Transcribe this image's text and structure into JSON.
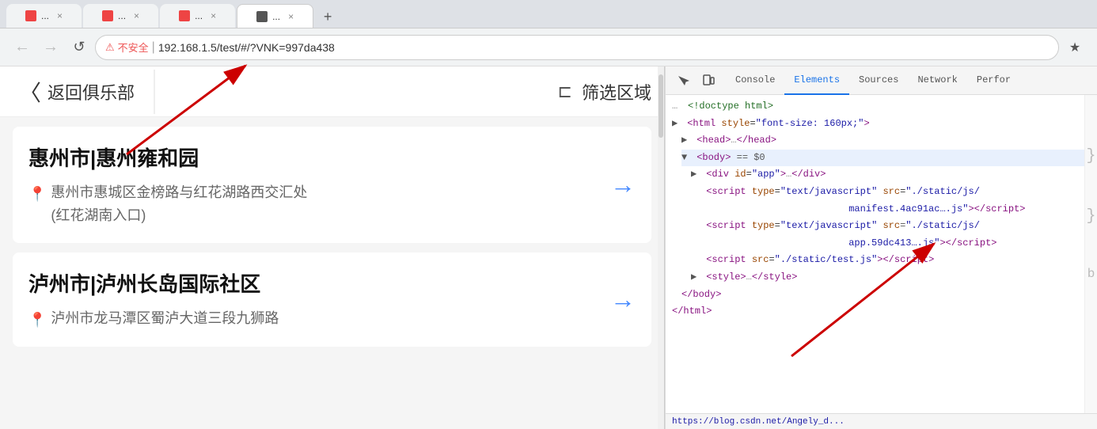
{
  "browser": {
    "tabs": [
      {
        "label": "...",
        "favicon_color": "#e44",
        "active": false
      },
      {
        "label": "...",
        "favicon_color": "#e44",
        "active": false
      },
      {
        "label": "...",
        "favicon_color": "#e44",
        "active": false
      },
      {
        "label": "...",
        "favicon_color": "#555",
        "active": true
      }
    ],
    "nav": {
      "back_label": "←",
      "forward_label": "→",
      "reload_label": "↺"
    },
    "address_bar": {
      "insecure": "不安全",
      "divider": "|",
      "url": "192.168.1.5/test/#/?VNK=997da438"
    }
  },
  "app": {
    "back_button_label": "〈",
    "back_text": "返回俱乐部",
    "filter_label": "筛选区域",
    "cards": [
      {
        "title": "惠州市|惠州雍和园",
        "address_line1": "惠州市惠城区金榜路与红花湖路西交汇处",
        "address_line2": "(红花湖南入口)"
      },
      {
        "title": "泸州市|泸州长岛国际社区",
        "address_line1": "泸州市龙马潭区蜀泸大道三段九狮路"
      }
    ]
  },
  "devtools": {
    "tabs": [
      {
        "label": "Console",
        "active": false
      },
      {
        "label": "Elements",
        "active": true
      },
      {
        "label": "Sources",
        "active": false
      },
      {
        "label": "Network",
        "active": false
      },
      {
        "label": "Perfor",
        "active": false
      }
    ],
    "icons": {
      "cursor": "⬚",
      "device": "▭"
    },
    "code_lines": [
      {
        "indent": 0,
        "expand": "",
        "content": "<!doctype html>",
        "type": "comment"
      },
      {
        "indent": 0,
        "expand": "▶",
        "content": "<html style=\"font-size: 160px;\">",
        "type": "tag"
      },
      {
        "indent": 1,
        "expand": "▶",
        "content": "<head>…</head>",
        "type": "tag"
      },
      {
        "indent": 1,
        "expand": "▼",
        "content": "<body> == $0",
        "type": "tag_highlight"
      },
      {
        "indent": 2,
        "expand": "▶",
        "content": "<div id=\"app\">…</div>",
        "type": "tag"
      },
      {
        "indent": 2,
        "expand": "",
        "content_parts": [
          {
            "text": "<script type=\"text/javascript\" src=\"",
            "type": "tag"
          },
          {
            "text": "./static/js/",
            "type": "normal"
          },
          {
            "text": "manifest.4ac91ac….js",
            "type": "link"
          },
          {
            "text": "\"></",
            "type": "tag"
          },
          {
            "text": "script>",
            "type": "tag"
          }
        ],
        "type": "mixed"
      },
      {
        "indent": 2,
        "expand": "",
        "content_parts": [
          {
            "text": "<script type=\"text/javascript\" src",
            "type": "tag"
          },
          {
            "text": "=\"",
            "type": "tag"
          },
          {
            "text": "./static/js/",
            "type": "normal"
          },
          {
            "text": "app.59dc413….js",
            "type": "link"
          },
          {
            "text": "\"></",
            "type": "tag"
          },
          {
            "text": "script>",
            "type": "tag"
          }
        ],
        "type": "mixed"
      },
      {
        "indent": 2,
        "expand": "",
        "content_parts": [
          {
            "text": "<script src=\"",
            "type": "tag"
          },
          {
            "text": "./static/test",
            "type": "link"
          },
          {
            "text": ".js\"></",
            "type": "tag"
          },
          {
            "text": "script>",
            "type": "tag"
          }
        ],
        "type": "mixed"
      },
      {
        "indent": 2,
        "expand": "▶",
        "content": "<style>…</style>",
        "type": "tag"
      },
      {
        "indent": 1,
        "expand": "",
        "content": "</body>",
        "type": "tag"
      },
      {
        "indent": 0,
        "expand": "",
        "content": "</html>",
        "type": "tag"
      }
    ]
  },
  "status_bar": {
    "url": "https://blog.csdn.net/Angely_d..."
  }
}
